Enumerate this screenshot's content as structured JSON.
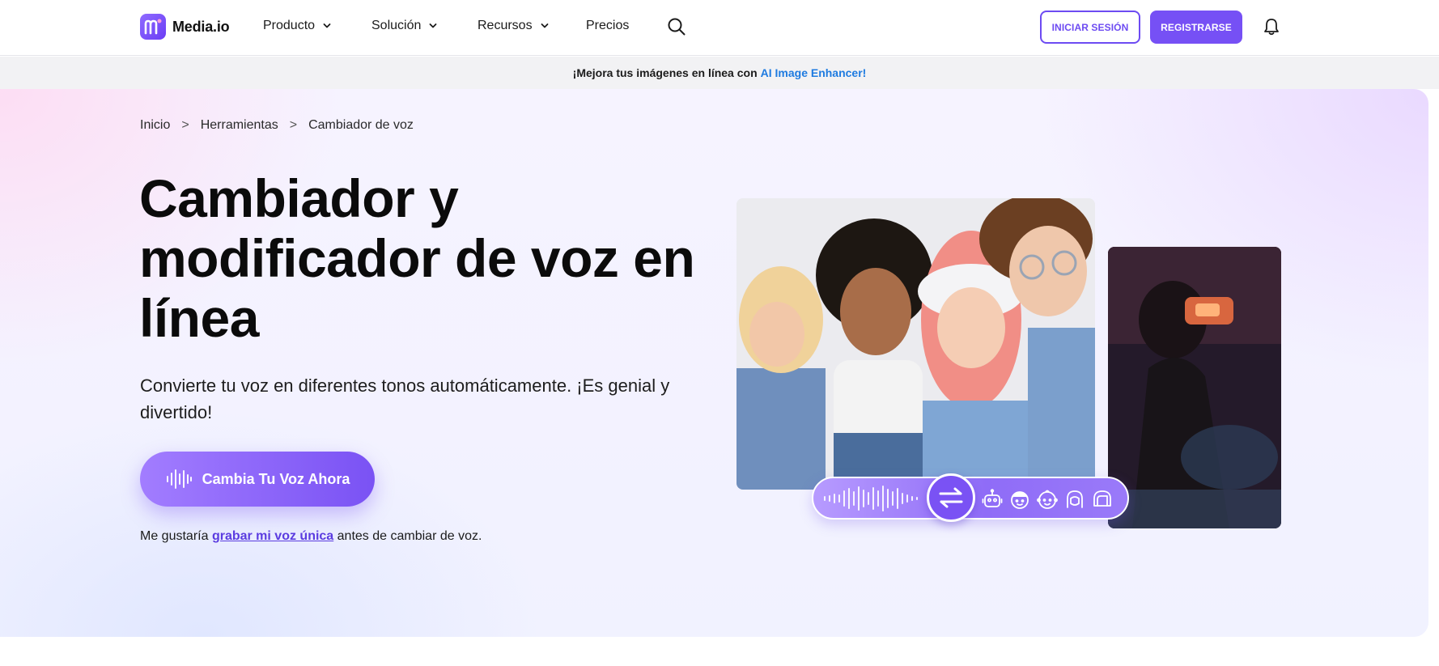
{
  "nav": {
    "logo_text": "Media.io",
    "items": [
      {
        "label": "Producto"
      },
      {
        "label": "Solución"
      },
      {
        "label": "Recursos"
      },
      {
        "label": "Precios"
      }
    ],
    "login_label": "INICIAR SESIÓN",
    "register_label": "REGISTRARSE"
  },
  "promo": {
    "text": "¡Mejora tus imágenes en línea con",
    "link": "AI Image Enhancer!"
  },
  "breadcrumb": {
    "items": [
      "Inicio",
      "Herramientas",
      "Cambiador de voz"
    ],
    "separator": ">"
  },
  "hero": {
    "title": "Cambiador y modificador de voz en línea",
    "description": "Convierte tu voz en diferentes tonos automáticamente. ¡Es genial y divertido!",
    "cta_label": "Cambia Tu Voz Ahora",
    "note_prefix": "Me gustaría",
    "note_link": "grabar mi voz única",
    "note_suffix": "antes de cambiar de voz."
  },
  "colors": {
    "brand": "#7650f5",
    "link": "#1e7be0",
    "note_link": "#5b3ce0"
  },
  "icons": [
    "search-icon",
    "chevron-down-icon",
    "bell-icon",
    "waveform-icon",
    "swap-arrows-icon",
    "robot-icon",
    "child-icon",
    "baby-icon",
    "girl-icon",
    "helmet-icon"
  ]
}
